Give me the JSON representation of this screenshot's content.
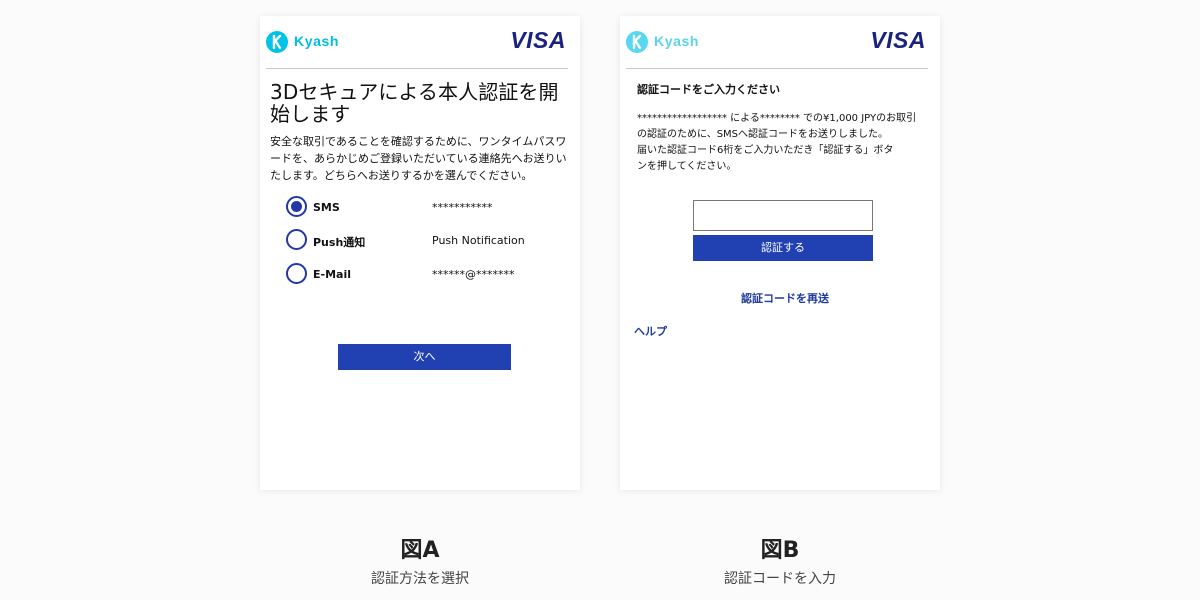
{
  "colors": {
    "brand_cyan": "#00c3e9",
    "visa_navy": "#1a237e",
    "button_blue": "#2140b2",
    "link_blue": "#1f3aa0"
  },
  "figure_a": {
    "brand": {
      "kyash_text": "Kyash",
      "visa_text": "VISA"
    },
    "title": "3Dセキュアによる本人認証を開始します",
    "description": "安全な取引であることを確認するために、ワンタイムパスワードを、あらかじめご登録いただいている連絡先へお送りいたします。どちらへお送りするかを選んでください。",
    "options": [
      {
        "label": "SMS",
        "value": "***********",
        "selected": true
      },
      {
        "label": "Push通知",
        "value": "Push Notification",
        "selected": false
      },
      {
        "label": "E-Mail",
        "value": "******@*******",
        "selected": false
      }
    ],
    "next_button": "次へ",
    "caption_title": "図A",
    "caption_subtitle": "認証方法を選択"
  },
  "figure_b": {
    "brand": {
      "kyash_text": "Kyash",
      "visa_text": "VISA"
    },
    "title": "認証コードをご入力ください",
    "description_lines": [
      "****************** による******** での¥1,000 JPYのお取引",
      "の認証のために、SMSへ認証コードをお送りしました。",
      "届いた認証コード6桁をご入力いただき「認証する」ボタ",
      "ンを押してください。"
    ],
    "code_input_value": "",
    "verify_button": "認証する",
    "resend_link": "認証コードを再送",
    "help_link": "ヘルプ",
    "caption_title": "図B",
    "caption_subtitle": "認証コードを入力"
  },
  "icons": {
    "kyash_logo": "kyash-logo-icon",
    "visa_logo": "visa-logo-icon",
    "radio_selected": "radio-selected-icon",
    "radio_unselected": "radio-unselected-icon"
  }
}
